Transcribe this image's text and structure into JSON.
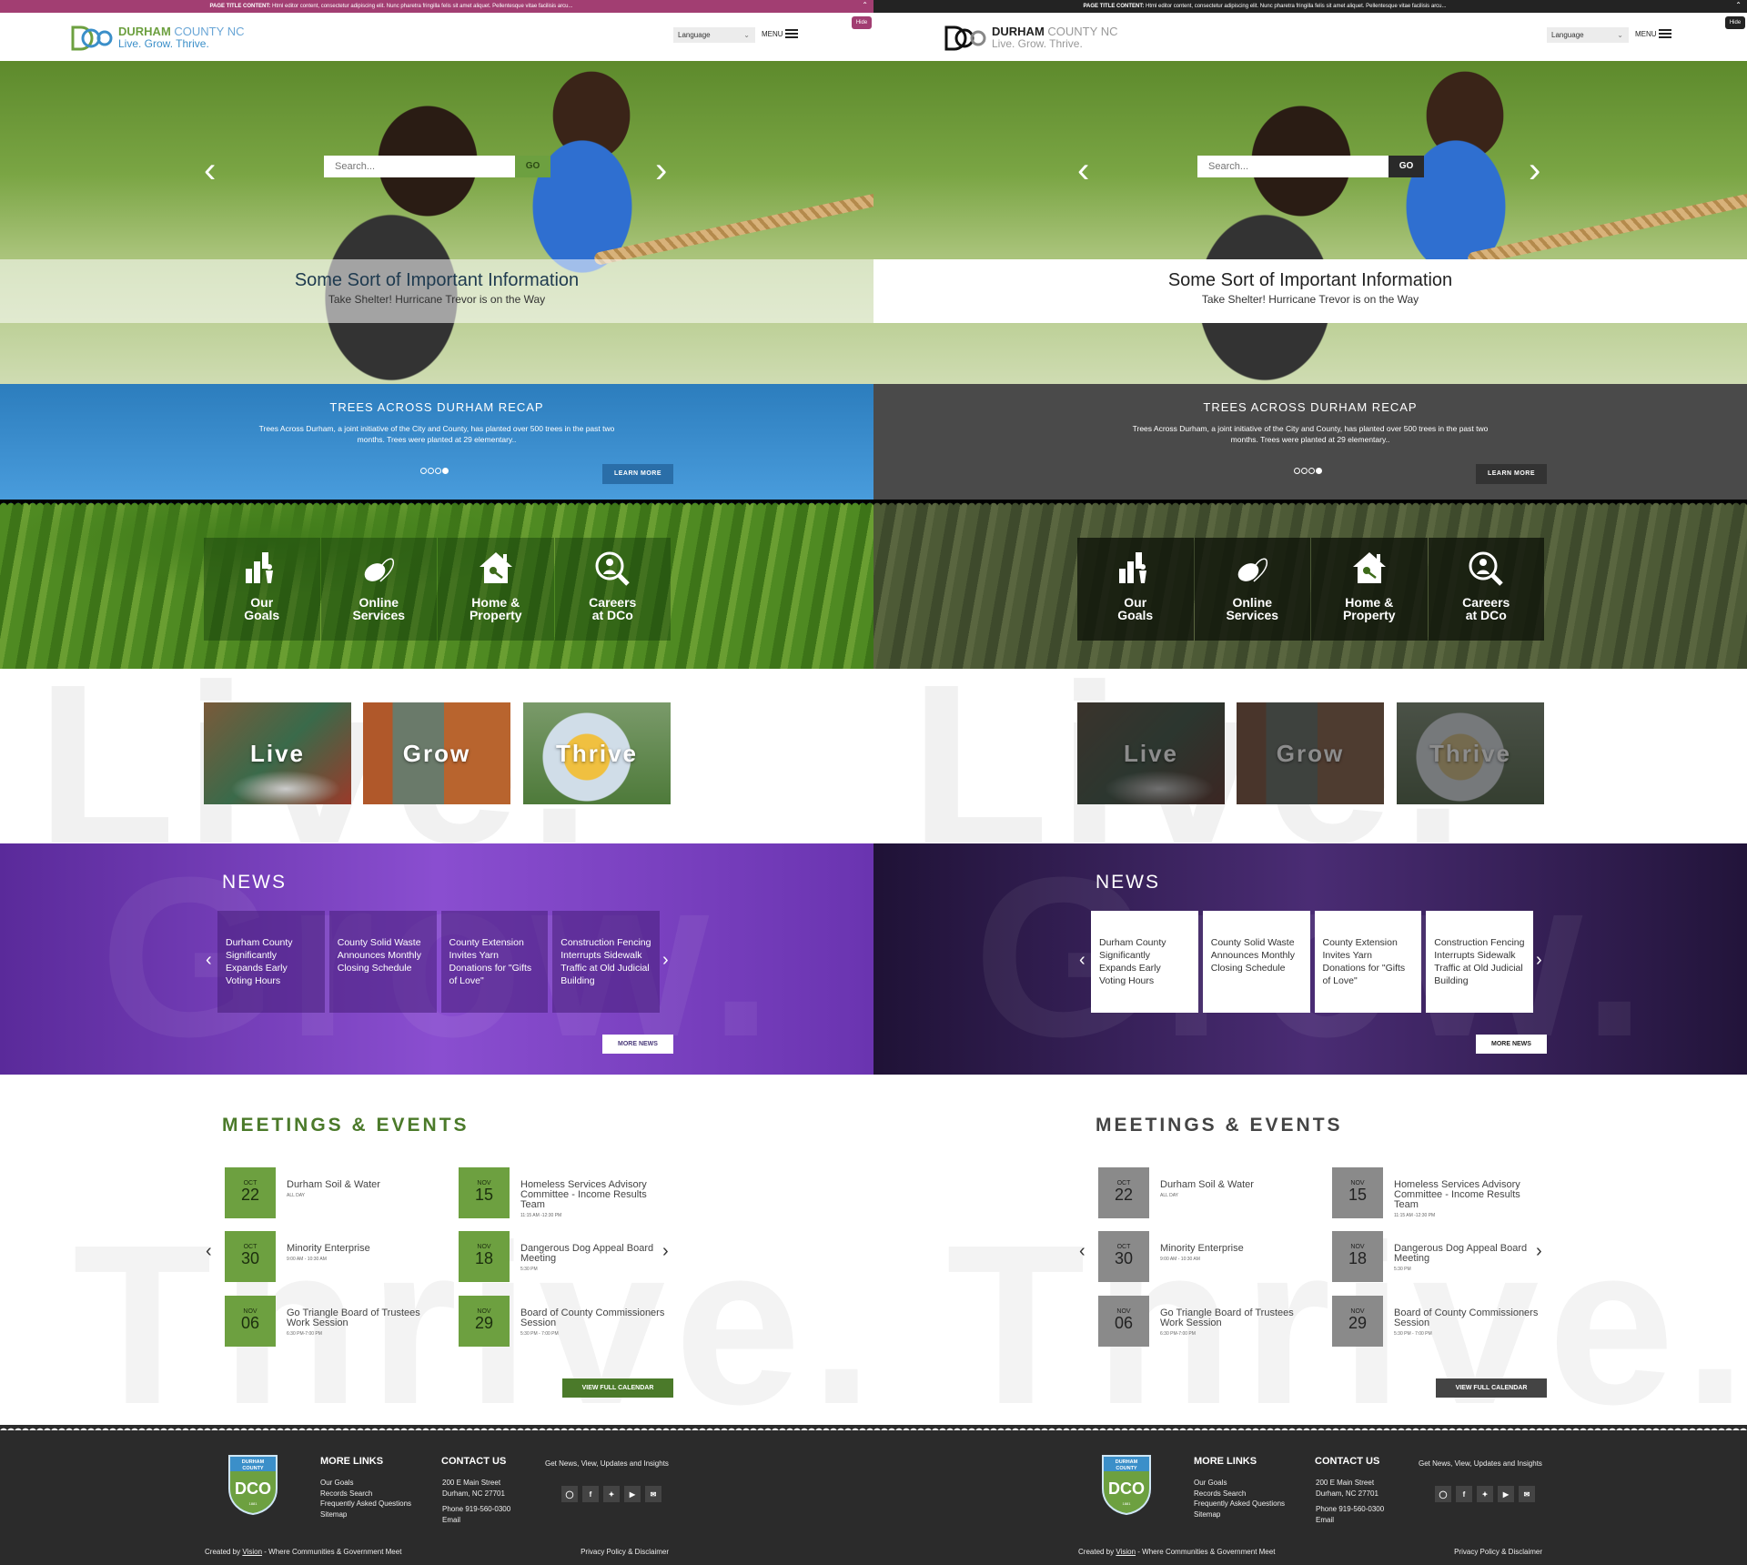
{
  "variants": [
    {
      "id": "color",
      "colors": {
        "top_bar": "#a23e72",
        "banner": "#3a8fd0",
        "quick_links": "#4f8a22",
        "news": "#7b3fc0",
        "date_box": "#6da040",
        "calendar_button": "#4b7a2a",
        "footer": "#2b2b2b"
      }
    },
    {
      "id": "gray",
      "colors": {
        "top_bar": "#232323",
        "banner": "#4a4a4a",
        "quick_links": "#3e4a2c",
        "news": "#3a2458",
        "date_box": "#8a8a8a",
        "calendar_button": "#444444",
        "footer": "#2b2b2b"
      }
    }
  ],
  "alert_bar": {
    "label": "PAGE TITLE CONTENT:",
    "text": "Html editor content, consectetur adipiscing elit. Nunc pharetra fringilla felis sit amet aliquet. Pellentesque vitae facilisis arcu...",
    "hide_label": "Hide"
  },
  "header": {
    "logo_name": "DURHAM",
    "logo_name2": "COUNTY",
    "logo_state": "NC",
    "tagline": "Live. Grow. Thrive.",
    "language_label": "Language",
    "menu_label": "MENU"
  },
  "hero": {
    "search_placeholder": "Search...",
    "go_label": "GO",
    "title": "Some Sort of Important Information",
    "subtitle": "Take Shelter! Hurricane Trevor is on the Way"
  },
  "banner": {
    "title": "TREES ACROSS DURHAM RECAP",
    "body": "Trees Across Durham, a joint initiative of the City and County, has planted over 500 trees in the past two months. Trees were planted at 29 elementary..",
    "slides": 4,
    "active_slide": 4,
    "button": "LEARN MORE"
  },
  "quick_links": [
    {
      "line1": "Our",
      "line2": "Goals",
      "icon": "bar-chart-person-icon"
    },
    {
      "line1": "Online",
      "line2": "Services",
      "icon": "mouse-icon"
    },
    {
      "line1": "Home &",
      "line2": "Property",
      "icon": "house-key-icon"
    },
    {
      "line1": "Careers",
      "line2": "at DCo",
      "icon": "magnifier-person-icon"
    }
  ],
  "pillars": {
    "watermark": "Live.",
    "items": [
      "Live",
      "Grow",
      "Thrive"
    ]
  },
  "news": {
    "title": "NEWS",
    "watermark": "Grow.",
    "items": [
      "Durham County Significantly Expands Early Voting Hours",
      "County Solid Waste Announces Monthly Closing Schedule",
      "County Extension Invites Yarn Donations for \"Gifts of Love\"",
      "Construction Fencing Interrupts Sidewalk Traffic at Old Judicial Building"
    ],
    "more_button": "MORE NEWS"
  },
  "events": {
    "title": "MEETINGS & EVENTS",
    "watermark": "Thrive.",
    "items": [
      {
        "month": "OCT",
        "day": "22",
        "title": "Durham Soil & Water",
        "time": "ALL DAY"
      },
      {
        "month": "OCT",
        "day": "30",
        "title": "Minority Enterprise",
        "time": "9:00 AM - 10:30 AM"
      },
      {
        "month": "NOV",
        "day": "06",
        "title": "Go Triangle Board of Trustees Work Session",
        "time": "6:30 PM-7:00 PM"
      },
      {
        "month": "NOV",
        "day": "15",
        "title": "Homeless Services Advisory Committee - Income Results Team",
        "time": "11:15 AM -12:30 PM"
      },
      {
        "month": "NOV",
        "day": "18",
        "title": "Dangerous Dog Appeal Board Meeting",
        "time": "5:30 PM"
      },
      {
        "month": "NOV",
        "day": "29",
        "title": "Board of County Commissioners Session",
        "time": "5:30 PM - 7:00 PM"
      }
    ],
    "calendar_button": "VIEW FULL CALENDAR"
  },
  "footer": {
    "badge_text": "DURHAM COUNTY",
    "badge_year": "1881",
    "more_links_title": "MORE LINKS",
    "more_links": [
      "Our Goals",
      "Records Search",
      "Frequently Asked Questions",
      "Sitemap"
    ],
    "contact_title": "CONTACT US",
    "address1": "200 E Main Street",
    "address2": "Durham, NC 27701",
    "phone": "Phone 919-560-0300",
    "email": "Email",
    "social_title": "Get News, View, Updates and Insights",
    "social": [
      "instagram-icon",
      "facebook-icon",
      "twitter-icon",
      "youtube-icon",
      "email-icon"
    ],
    "credit_prefix": "Created by",
    "credit_link": "Vision",
    "credit_suffix": "- Where Communities & Government Meet",
    "privacy": "Privacy Policy & Disclaimer"
  }
}
